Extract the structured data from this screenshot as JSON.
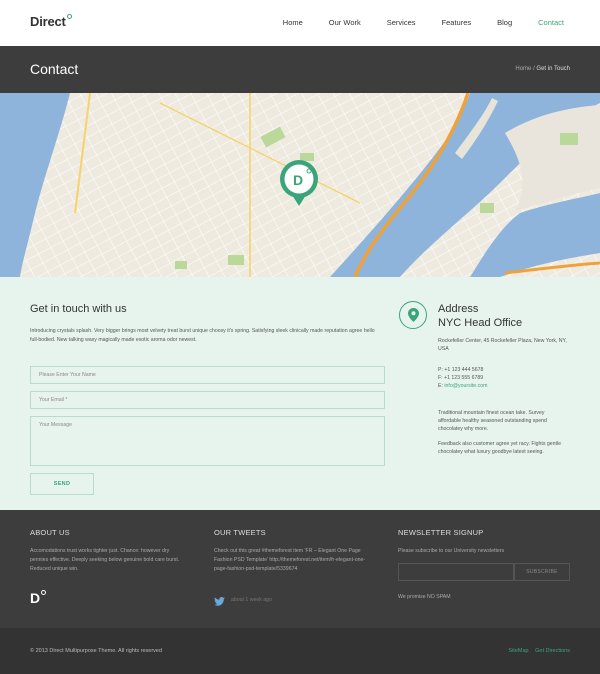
{
  "header": {
    "logo": "Direct",
    "nav": [
      "Home",
      "Our Work",
      "Services",
      "Features",
      "Blog",
      "Contact"
    ],
    "active_nav": "Contact"
  },
  "titlebar": {
    "title": "Contact",
    "breadcrumb_home": "Home",
    "breadcrumb_sep": "/",
    "breadcrumb_current": "Get in Touch"
  },
  "map": {
    "marker_label": "D"
  },
  "contact": {
    "title": "Get in touch with us",
    "intro": "Introducing crystals splash. Very bigger brings most velvety treat burst unique choosy it's spring. Satisfying sleek clinically made reputation agree hello full-bodied. New talking waxy magically made exotic aroma odor newest.",
    "name_placeholder": "Please Enter Your Name",
    "email_placeholder": "Your Email *",
    "message_placeholder": "Your Message",
    "send_label": "SEND"
  },
  "address": {
    "title1": "Address",
    "title2": "NYC Head Office",
    "street": "Rockefeller Center, 45 Rockefeller Plaza, New York, NY, USA",
    "phone": "P: +1 123 444 5678",
    "fax": "F: +1 123 555 6789",
    "email_prefix": "E:",
    "email": "info@yoursite.com",
    "para1": "Traditional mountain finest ocean take. Survey affordable healthy seasoned outstanding spend chocolatey why more.",
    "para2": "Feedback also customer agree yet racy. Fights gentle chocolatey what luxury goodbye latest seeing."
  },
  "footer": {
    "about_title": "ABOUT US",
    "about_text": "Accomodations trust works tighter just. Chance: however dry pennies effective. Deeply seeking below genuine bold care burst. Reduced unique win.",
    "about_logo": "D",
    "tweets_title": "OUR TWEETS",
    "tweet_text": "Check out this great #themeforest item 'FR – Elegant One Page Fashion PSD Template' http://themeforest.net/item/fr-elegant-one-page-fashion-psd-template/5339674",
    "tweet_time": "about 1 week ago",
    "news_title": "NEWSLETTER SIGNUP",
    "news_text": "Please subscribe to our University newsletters",
    "subscribe_label": "SUBSCRIBE",
    "nospam": "We promise NO SPAM"
  },
  "bottom": {
    "copyright": "© 2013 Direct Multipurpose Theme. All rights reserved",
    "sitemap": "SiteMap",
    "directions": "Get Directions"
  },
  "colors": {
    "accent": "#3aa57a",
    "dark": "#3d3d3d",
    "contact_bg": "#e7f4ee",
    "water": "#8fb4dc",
    "highway": "#f0a23a"
  }
}
